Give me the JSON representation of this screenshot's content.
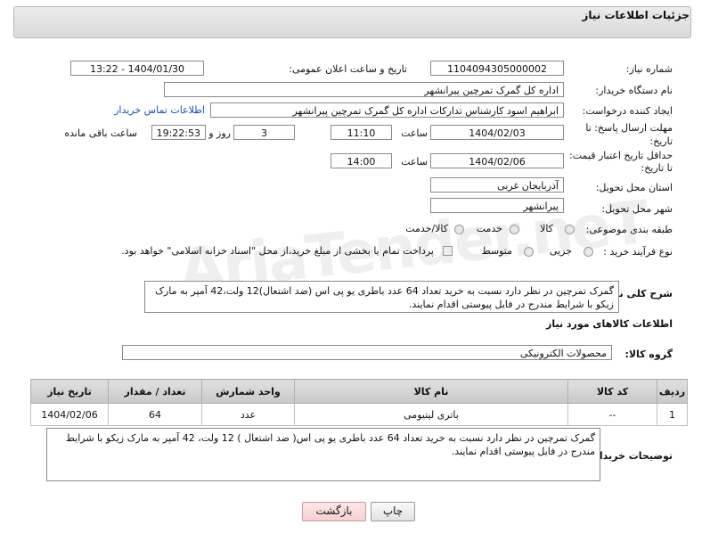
{
  "header": {
    "title": "جزئیات اطلاعات نیاز"
  },
  "fields": {
    "need_number_label": "شماره نیاز:",
    "need_number": "1104094305000002",
    "announce_label": "تاریخ و ساعت اعلان عمومی:",
    "announce_value": "1404/01/30 - 13:22",
    "buyer_org_label": "نام دستگاه خریدار:",
    "buyer_org": "اداره کل گمرک تمرچین پیرانشهر",
    "creator_label": "ایجاد کننده درخواست:",
    "creator": "ابراهیم اسود کارشناس تدارکات اداره کل گمرک تمرچین پیرانشهر",
    "contact_link": "اطلاعات تماس خریدار",
    "deadline_label_1": "مهلت ارسال پاسخ: تا",
    "deadline_label_2": "تاریخ:",
    "deadline_date": "1404/02/03",
    "hour_label": "ساعت",
    "deadline_time": "11:10",
    "days_value": "3",
    "days_label": "روز و",
    "remaining_value": "19:22:53",
    "remaining_label": "ساعت باقی مانده",
    "validity_label_1": "حداقل تاریخ اعتبار قیمت:",
    "validity_label_2": "تا تاریخ:",
    "validity_date": "1404/02/06",
    "validity_time": "14:00",
    "province_label": "استان محل تحویل:",
    "province": "آذربایجان غربی",
    "city_label": "شهر محل تحویل:",
    "city": "پیرانشهر",
    "category_label": "طبقه بندی موضوعی:",
    "category_options": [
      "کالا",
      "خدمت",
      "کالا/خدمت"
    ],
    "process_label": "نوع فرآیند خرید :",
    "process_options": [
      "جزیی",
      "متوسط"
    ],
    "payment_note": "پرداخت تمام یا بخشی از مبلغ خرید،از محل \"اسناد خزانه اسلامی\" خواهد بود.",
    "summary_label": "شرح کلی نیاز:",
    "summary": "گمرک تمرچین در نظر دارد نسبت به خرید تعداد 64 عدد باطری یو پی اس (ضد اشتعال)12 ولت،42 آمپر به مارک زیکو با شرایط مندرج در فایل پیوستی اقدام نمایند."
  },
  "goods": {
    "section_title": "اطلاعات کالاهای مورد نیاز",
    "group_label": "گروه کالا:",
    "group_value": "محصولات الکترونیکی",
    "columns": [
      "ردیف",
      "کد کالا",
      "نام کالا",
      "واحد شمارش",
      "تعداد / مقدار",
      "تاریخ نیاز"
    ],
    "rows": [
      {
        "row": "1",
        "code": "--",
        "name": "باتری لیتیومی",
        "unit": "عدد",
        "qty": "64",
        "date": "1404/02/06"
      }
    ]
  },
  "buyer_notes": {
    "label": "توضیحات خریدار:",
    "text": "گمرک تمرچین در نظر دارد نسبت به خرید تعداد 64 عدد باطری یو پی اس( ضد اشتعال )  12 ولت، 42 آمپر به مارک زیکو با شرایط مندرج در فایل پیوستی اقدام نمایند."
  },
  "buttons": {
    "print": "چاپ",
    "back": "بازگشت"
  },
  "colors": {
    "link": "#1a4ea8",
    "back_button": "#f6cfd3"
  }
}
